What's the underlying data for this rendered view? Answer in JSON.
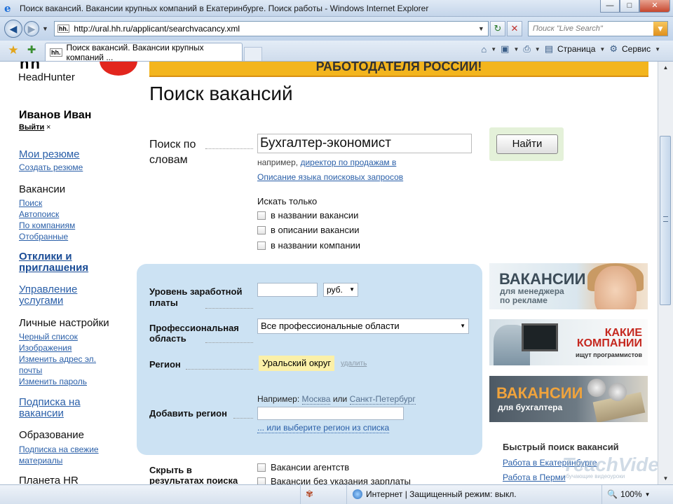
{
  "window": {
    "title": "Поиск вакансий. Вакансии крупных компаний в Екатеринбурге. Поиск работы - Windows Internet Explorer"
  },
  "toolbar": {
    "url": "http://ural.hh.ru/applicant/searchvacancy.xml",
    "search_placeholder": "Поиск \"Live Search\"",
    "tab_title": "Поиск вакансий. Вакансии крупных компаний ...",
    "favicon": "hh.",
    "page_menu": "Страница",
    "tools_menu": "Сервис"
  },
  "logo": {
    "text": "HeadHunter",
    "mark": "hh"
  },
  "user": {
    "name": "Иванов Иван",
    "logout": "Выйти",
    "logout_x": "×"
  },
  "sidebar": {
    "resume_title": "Мои резюме",
    "create_resume": "Создать резюме",
    "vacancies_title": "Вакансии",
    "vacancies_links": [
      "Поиск",
      "Автопоиск",
      "По компаниям",
      "Отобранные"
    ],
    "responses": "Отклики и приглашения",
    "services": "Управление услугами",
    "settings_title": "Личные настройки",
    "settings_links": [
      "Черный список",
      "Изображения",
      "Изменить адрес эл. почты",
      "Изменить пароль"
    ],
    "subscription": "Подписка на вакансии",
    "education_title": "Образование",
    "education_links": [
      "Подписка на свежие материалы"
    ],
    "planet": "Планета HR"
  },
  "banner": {
    "text": "РАБОТОДАТЕЛЯ РОССИИ!"
  },
  "main": {
    "title": "Поиск вакансий",
    "keywords_label": "Поиск по словам",
    "keywords_value": "Бухгалтер-экономист",
    "find_button": "Найти",
    "hint_prefix": "например,",
    "hint_link": "директор по продажам в",
    "lang_link": "Описание языка поисковых запросов",
    "only_label": "Искать только",
    "checkboxes": [
      "в названии вакансии",
      "в описании вакансии",
      "в названии компании"
    ],
    "salary_label": "Уровень заработной платы",
    "currency": "руб.",
    "prof_label": "Профессиональная область",
    "prof_value": "Все профессиональные области",
    "region_label": "Регион",
    "region_value": "Уральский округ",
    "region_delete": "удалить",
    "add_region_label": "Добавить регион",
    "example_prefix": "Например:",
    "example_city1": "Москва",
    "example_or": "или",
    "example_city2": "Санкт-Петербург",
    "region_list_link": "... или выберите регион из списка",
    "hide_label": "Скрыть в результатах поиска",
    "hide_options": [
      "Вакансии агентств",
      "Вакансии без указания зарплаты"
    ]
  },
  "ads": {
    "ad1_big": "ВАКАНСИИ",
    "ad1_small": "для менеджера по рекламе",
    "ad2_big": "КАКИЕ КОМПАНИИ",
    "ad2_small": "ищут программистов",
    "ad3_big": "ВАКАНСИИ",
    "ad3_small": "для бухгалтера"
  },
  "quick": {
    "title": "Быстрый поиск вакансий",
    "links": [
      "Работа в Екатеринбурге",
      "Работа в Перми"
    ]
  },
  "watermark": {
    "text": "TeachVideo",
    "sub": "обучающие видеоуроки"
  },
  "status": {
    "zone": "Интернет | Защищенный режим: выкл.",
    "zoom": "100%"
  },
  "colors": {
    "banner": "#f3b51e",
    "panel": "#cce2f3",
    "link": "#2a5fa8",
    "region_tag": "#fbf0a8"
  }
}
